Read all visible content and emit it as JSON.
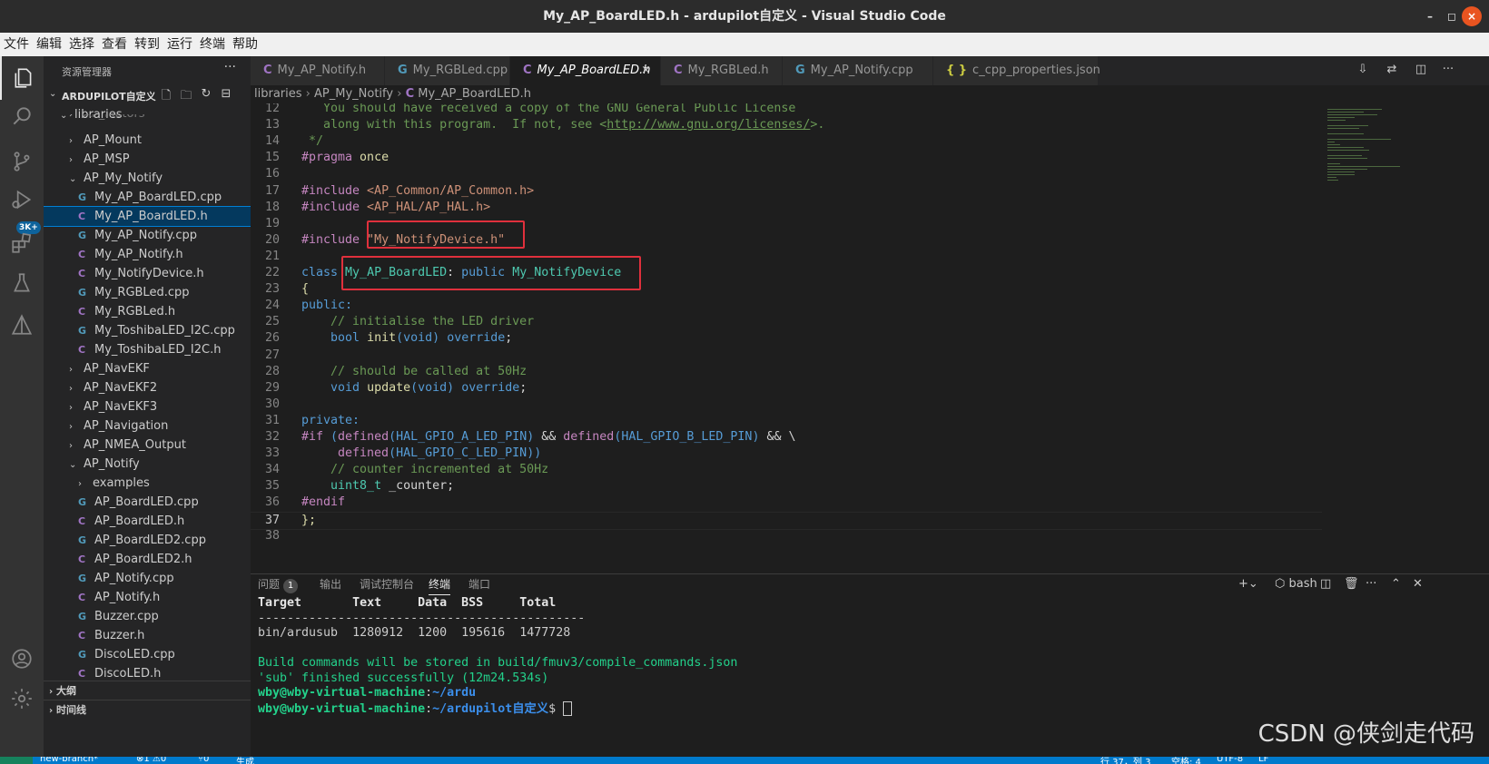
{
  "window": {
    "title": "My_AP_BoardLED.h - ardupilot自定义 - Visual Studio Code",
    "close": "×",
    "maximize": "◻",
    "minimize": "–"
  },
  "menu": [
    "文件",
    "编辑",
    "选择",
    "查看",
    "转到",
    "运行",
    "终端",
    "帮助"
  ],
  "activity": {
    "scm_badge": "3K+"
  },
  "sidebar": {
    "title": "资源管理器",
    "more": "···",
    "root": "ARDUPILOT自定义",
    "tree": [
      {
        "label": "libraries",
        "type": "folder",
        "open": true,
        "indent": 1
      },
      {
        "label": "AP_Motors",
        "type": "folder",
        "open": false,
        "indent": 2
      },
      {
        "label": "AP_Mount",
        "type": "folder",
        "open": false,
        "indent": 2
      },
      {
        "label": "AP_MSP",
        "type": "folder",
        "open": false,
        "indent": 2
      },
      {
        "label": "AP_My_Notify",
        "type": "folder",
        "open": true,
        "indent": 2
      },
      {
        "label": "My_AP_BoardLED.cpp",
        "type": "cpp",
        "indent": 3
      },
      {
        "label": "My_AP_BoardLED.h",
        "type": "h",
        "indent": 3,
        "selected": true
      },
      {
        "label": "My_AP_Notify.cpp",
        "type": "cpp",
        "indent": 3
      },
      {
        "label": "My_AP_Notify.h",
        "type": "h",
        "indent": 3
      },
      {
        "label": "My_NotifyDevice.h",
        "type": "h",
        "indent": 3
      },
      {
        "label": "My_RGBLed.cpp",
        "type": "cpp",
        "indent": 3
      },
      {
        "label": "My_RGBLed.h",
        "type": "h",
        "indent": 3
      },
      {
        "label": "My_ToshibaLED_I2C.cpp",
        "type": "cpp",
        "indent": 3
      },
      {
        "label": "My_ToshibaLED_I2C.h",
        "type": "h",
        "indent": 3
      },
      {
        "label": "AP_NavEKF",
        "type": "folder",
        "open": false,
        "indent": 2
      },
      {
        "label": "AP_NavEKF2",
        "type": "folder",
        "open": false,
        "indent": 2
      },
      {
        "label": "AP_NavEKF3",
        "type": "folder",
        "open": false,
        "indent": 2
      },
      {
        "label": "AP_Navigation",
        "type": "folder",
        "open": false,
        "indent": 2
      },
      {
        "label": "AP_NMEA_Output",
        "type": "folder",
        "open": false,
        "indent": 2
      },
      {
        "label": "AP_Notify",
        "type": "folder",
        "open": true,
        "indent": 2
      },
      {
        "label": "examples",
        "type": "folder",
        "open": false,
        "indent": 3
      },
      {
        "label": "AP_BoardLED.cpp",
        "type": "cpp",
        "indent": 3
      },
      {
        "label": "AP_BoardLED.h",
        "type": "h",
        "indent": 3
      },
      {
        "label": "AP_BoardLED2.cpp",
        "type": "cpp",
        "indent": 3
      },
      {
        "label": "AP_BoardLED2.h",
        "type": "h",
        "indent": 3
      },
      {
        "label": "AP_Notify.cpp",
        "type": "cpp",
        "indent": 3
      },
      {
        "label": "AP_Notify.h",
        "type": "h",
        "indent": 3
      },
      {
        "label": "Buzzer.cpp",
        "type": "cpp",
        "indent": 3
      },
      {
        "label": "Buzzer.h",
        "type": "h",
        "indent": 3
      },
      {
        "label": "DiscoLED.cpp",
        "type": "cpp",
        "indent": 3
      },
      {
        "label": "DiscoLED.h",
        "type": "h",
        "indent": 3
      }
    ],
    "outline": "大纲",
    "timeline": "时间线"
  },
  "tabs": [
    {
      "label": "My_AP_Notify.h",
      "type": "h"
    },
    {
      "label": "My_RGBLed.cpp",
      "type": "cpp"
    },
    {
      "label": "My_AP_BoardLED.h",
      "type": "h",
      "active": true
    },
    {
      "label": "My_RGBLed.h",
      "type": "h"
    },
    {
      "label": "My_AP_Notify.cpp",
      "type": "cpp"
    },
    {
      "label": "c_cpp_properties.json",
      "type": "json"
    }
  ],
  "breadcrumbs": [
    "libraries",
    "AP_My_Notify",
    "My_AP_BoardLED.h"
  ],
  "code": [
    {
      "n": "12",
      "t": [
        [
          "   You should have received a copy of the GNU General Public License",
          "k-c"
        ]
      ]
    },
    {
      "n": "13",
      "t": [
        [
          "   along with this program.  If not, see <",
          "k-c"
        ],
        [
          "http://www.gnu.org/licenses/",
          "k-url"
        ],
        [
          ">.",
          "k-c"
        ]
      ]
    },
    {
      "n": "14",
      "t": [
        [
          " */",
          "k-c"
        ]
      ]
    },
    {
      "n": "15",
      "t": [
        [
          "#pragma",
          "k-pp"
        ],
        [
          " once",
          "k-fn"
        ]
      ]
    },
    {
      "n": "16",
      "t": []
    },
    {
      "n": "17",
      "t": [
        [
          "#include",
          "k-pp"
        ],
        [
          " <AP_Common/AP_Common.h>",
          "k-str"
        ]
      ]
    },
    {
      "n": "18",
      "t": [
        [
          "#include",
          "k-pp"
        ],
        [
          " <AP_HAL/AP_HAL.h>",
          "k-str"
        ]
      ]
    },
    {
      "n": "19",
      "t": []
    },
    {
      "n": "20",
      "t": [
        [
          "#include",
          "k-pp"
        ],
        [
          " ",
          "k-tx"
        ],
        [
          "\"My_NotifyDevice.h\"",
          "k-str"
        ]
      ]
    },
    {
      "n": "21",
      "t": []
    },
    {
      "n": "22",
      "t": [
        [
          "class",
          "k-kw"
        ],
        [
          " ",
          "k-tx"
        ],
        [
          "My_AP_BoardLED",
          "k-ty"
        ],
        [
          ": ",
          "k-tx"
        ],
        [
          "public",
          "k-kw"
        ],
        [
          " ",
          "k-tx"
        ],
        [
          "My_NotifyDevice",
          "k-ty"
        ]
      ]
    },
    {
      "n": "23",
      "t": [
        [
          "{",
          "k-fn"
        ]
      ]
    },
    {
      "n": "24",
      "t": [
        [
          "public:",
          "k-kw"
        ]
      ]
    },
    {
      "n": "25",
      "t": [
        [
          "    // initialise the LED driver",
          "k-c"
        ]
      ]
    },
    {
      "n": "26",
      "t": [
        [
          "    ",
          "k-tx"
        ],
        [
          "bool",
          "k-kw"
        ],
        [
          " ",
          "k-tx"
        ],
        [
          "init",
          "k-fn"
        ],
        [
          "(",
          "k-kw"
        ],
        [
          "void",
          "k-kw"
        ],
        [
          ")",
          "k-kw"
        ],
        [
          " ",
          "k-tx"
        ],
        [
          "override",
          "k-kw"
        ],
        [
          ";",
          "k-tx"
        ]
      ]
    },
    {
      "n": "27",
      "t": []
    },
    {
      "n": "28",
      "t": [
        [
          "    // should be called at 50Hz",
          "k-c"
        ]
      ]
    },
    {
      "n": "29",
      "t": [
        [
          "    ",
          "k-tx"
        ],
        [
          "void",
          "k-kw"
        ],
        [
          " ",
          "k-tx"
        ],
        [
          "update",
          "k-fn"
        ],
        [
          "(",
          "k-kw"
        ],
        [
          "void",
          "k-kw"
        ],
        [
          ")",
          "k-kw"
        ],
        [
          " ",
          "k-tx"
        ],
        [
          "override",
          "k-kw"
        ],
        [
          ";",
          "k-tx"
        ]
      ]
    },
    {
      "n": "30",
      "t": []
    },
    {
      "n": "31",
      "t": [
        [
          "private:",
          "k-kw"
        ]
      ]
    },
    {
      "n": "32",
      "t": [
        [
          "#if",
          "k-pp"
        ],
        [
          " (",
          "k-kw"
        ],
        [
          "defined",
          "k-pp"
        ],
        [
          "(",
          "k-kw"
        ],
        [
          "HAL_GPIO_A_LED_PIN",
          "k-mac"
        ],
        [
          ")",
          "k-kw"
        ],
        [
          " && ",
          "k-tx"
        ],
        [
          "defined",
          "k-pp"
        ],
        [
          "(",
          "k-kw"
        ],
        [
          "HAL_GPIO_B_LED_PIN",
          "k-mac"
        ],
        [
          ")",
          "k-kw"
        ],
        [
          " && \\",
          "k-tx"
        ]
      ]
    },
    {
      "n": "33",
      "t": [
        [
          "     defined",
          "k-pp"
        ],
        [
          "(",
          "k-kw"
        ],
        [
          "HAL_GPIO_C_LED_PIN",
          "k-mac"
        ],
        [
          "))",
          "k-kw"
        ]
      ]
    },
    {
      "n": "34",
      "t": [
        [
          "    // counter incremented at 50Hz",
          "k-c"
        ]
      ]
    },
    {
      "n": "35",
      "t": [
        [
          "    ",
          "k-tx"
        ],
        [
          "uint8_t",
          "k-ty"
        ],
        [
          " _counter;",
          "k-tx"
        ]
      ]
    },
    {
      "n": "36",
      "t": [
        [
          "#endif",
          "k-pp"
        ]
      ]
    },
    {
      "n": "37",
      "t": [
        [
          "};",
          "k-fn"
        ]
      ],
      "cur": true
    },
    {
      "n": "38",
      "t": []
    }
  ],
  "panel": {
    "tabs": [
      "问题",
      "输出",
      "调试控制台",
      "终端",
      "端口"
    ],
    "problems_count": "1",
    "shell": "bash",
    "terminal": {
      "header": "Target       Text     Data  BSS     Total",
      "rule": "---------------------------------------------",
      "row": "bin/ardusub  1280912  1200  195616  1477728",
      "blank": "",
      "build1": "Build commands will be stored in build/fmuv3/compile_commands.json",
      "build2": "'sub' finished successfully (12m24.534s)",
      "p1_user": "wby@wby-virtual-machine",
      "p1_path": "~/ardu",
      "p2_user": "wby@wby-virtual-machine",
      "p2_path": "~/ardupilot自定义",
      "p2_sym": "$ "
    }
  },
  "status": {
    "branch": "new-branch*",
    "errors": "⊗1 ⚠0",
    "ports": "⑂0",
    "build": "生成",
    "cursor": "行 37，列 3",
    "spaces": "空格: 4",
    "encoding": "UTF-8",
    "eol": "LF"
  },
  "watermark": "CSDN @侠剑走代码"
}
